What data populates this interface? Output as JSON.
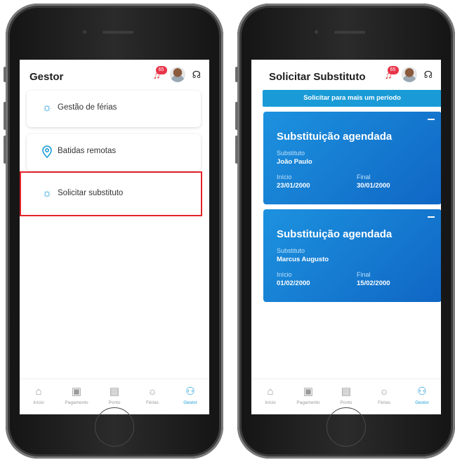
{
  "left_screen": {
    "title": "Gestor",
    "badge_count": "65",
    "menu": [
      {
        "label": "Gestão de férias",
        "icon": "sun-icon"
      },
      {
        "label": "Batidas remotas",
        "icon": "location-pin-icon"
      },
      {
        "label": "Solicitar substituto",
        "icon": "sun-icon"
      }
    ]
  },
  "right_screen": {
    "title": "Solicitar Substituto",
    "badge_count": "65",
    "add_period_button": "Solicitar para mais um período",
    "cards": [
      {
        "title": "Substituição agendada",
        "substitute_label": "Substituto",
        "substitute": "João Paulo",
        "start_label": "Início",
        "start": "23/01/2000",
        "end_label": "Final",
        "end": "30/01/2000"
      },
      {
        "title": "Substituição agendada",
        "substitute_label": "Substituto",
        "substitute": "Marcus Augusto",
        "start_label": "Início",
        "start": "01/02/2000",
        "end_label": "Final",
        "end": "15/02/2000"
      }
    ]
  },
  "nav": [
    {
      "label": "Início",
      "icon": "home-icon"
    },
    {
      "label": "Pagamento",
      "icon": "wallet-icon"
    },
    {
      "label": "Ponto",
      "icon": "document-icon"
    },
    {
      "label": "Férias",
      "icon": "sun-icon"
    },
    {
      "label": "Gestor",
      "icon": "people-icon"
    }
  ],
  "colors": {
    "accent": "#1a9bd7",
    "highlight": "#e3242b",
    "card_gradient_start": "#1d92df",
    "card_gradient_end": "#0f66c4"
  }
}
